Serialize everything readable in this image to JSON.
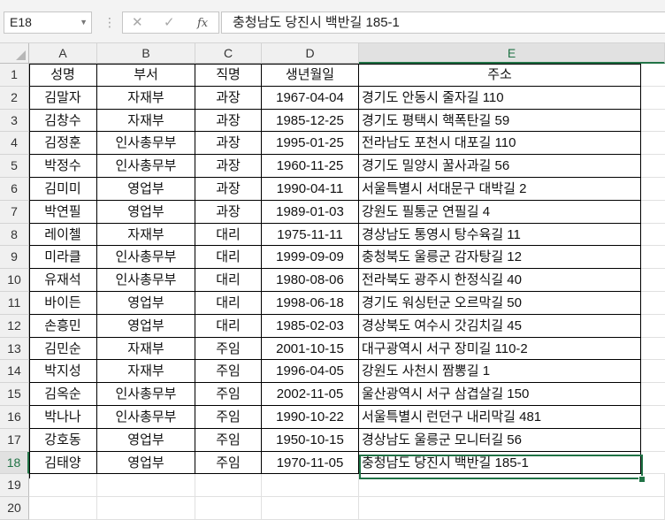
{
  "name_box": "E18",
  "formula_bar": "충청남도 당진시 백반길 185-1",
  "columns": [
    "A",
    "B",
    "C",
    "D",
    "E"
  ],
  "row_numbers": [
    "1",
    "2",
    "3",
    "4",
    "5",
    "6",
    "7",
    "8",
    "9",
    "10",
    "11",
    "12",
    "13",
    "14",
    "15",
    "16",
    "17",
    "18",
    "19",
    "20"
  ],
  "header": [
    "성명",
    "부서",
    "직명",
    "생년월일",
    "주소"
  ],
  "rows": [
    [
      "김말자",
      "자재부",
      "과장",
      "1967-04-04",
      "경기도 안동시 줄자길 110"
    ],
    [
      "김창수",
      "자재부",
      "과장",
      "1985-12-25",
      "경기도 평택시 핵폭탄길 59"
    ],
    [
      "김정훈",
      "인사총무부",
      "과장",
      "1995-01-25",
      "전라남도 포천시 대포길 110"
    ],
    [
      "박정수",
      "인사총무부",
      "과장",
      "1960-11-25",
      "경기도 밀양시 꿀사과길 56"
    ],
    [
      "김미미",
      "영업부",
      "과장",
      "1990-04-11",
      "서울특별시 서대문구 대박길 2"
    ],
    [
      "박연필",
      "영업부",
      "과장",
      "1989-01-03",
      "강원도 필통군 연필길 4"
    ],
    [
      "레이첼",
      "자재부",
      "대리",
      "1975-11-11",
      "경상남도 통영시 탕수육길 11"
    ],
    [
      "미라클",
      "인사총무부",
      "대리",
      "1999-09-09",
      "충청북도 울릉군 감자탕길 12"
    ],
    [
      "유재석",
      "인사총무부",
      "대리",
      "1980-08-06",
      "전라북도 광주시 한정식길 40"
    ],
    [
      "바이든",
      "영업부",
      "대리",
      "1998-06-18",
      "경기도 워싱턴군 오르막길 50"
    ],
    [
      "손흥민",
      "영업부",
      "대리",
      "1985-02-03",
      "경상북도 여수시 갓김치길 45"
    ],
    [
      "김민순",
      "자재부",
      "주임",
      "2001-10-15",
      "대구광역시 서구 장미길 110-2"
    ],
    [
      "박지성",
      "자재부",
      "주임",
      "1996-04-05",
      "강원도 사천시 짬뽕길 1"
    ],
    [
      "김옥순",
      "인사총무부",
      "주임",
      "2002-11-05",
      "울산광역시 서구 삼겹살길 150"
    ],
    [
      "박나나",
      "인사총무부",
      "주임",
      "1990-10-22",
      "서울특별시 런던구 내리막길 481"
    ],
    [
      "강호동",
      "영업부",
      "주임",
      "1950-10-15",
      "경상남도 울릉군 모니터길 56"
    ],
    [
      "김태양",
      "영업부",
      "주임",
      "1970-11-05",
      "충청남도 당진시 백반길 185-1"
    ]
  ],
  "icons": {
    "cancel": "close-icon",
    "enter": "check-icon",
    "function": "fx-icon"
  },
  "accent_color": "#217346"
}
